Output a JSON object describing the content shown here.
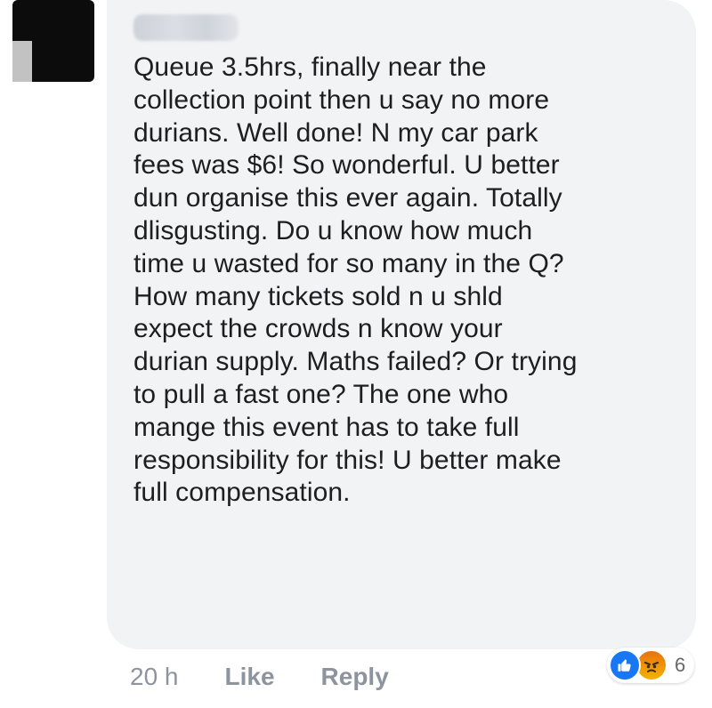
{
  "comment": {
    "lines": [
      "Queue 3.5hrs, finally near the",
      "collection point then u say no more",
      "durians. Well done! N my car park",
      "fees was $6! So wonderful. U better",
      "dun organise this ever  again. Totally",
      "dlisgusting. Do u know how much",
      "time u wasted for so many in the Q?",
      "How many tickets sold n u shld",
      "expect the crowds n know your",
      "durian supply. Maths failed? Or trying",
      "to pull a fast one? The one who",
      "mange this event has to take full",
      "responsibility for this! U better make",
      "full compensation."
    ]
  },
  "actions": {
    "time": "20 h",
    "like_label": "Like",
    "reply_label": "Reply"
  },
  "reactions": {
    "count": "6",
    "types": [
      "like-icon",
      "angry-icon"
    ],
    "like_color": "#1877f2",
    "angry_color": "#f4b400"
  }
}
